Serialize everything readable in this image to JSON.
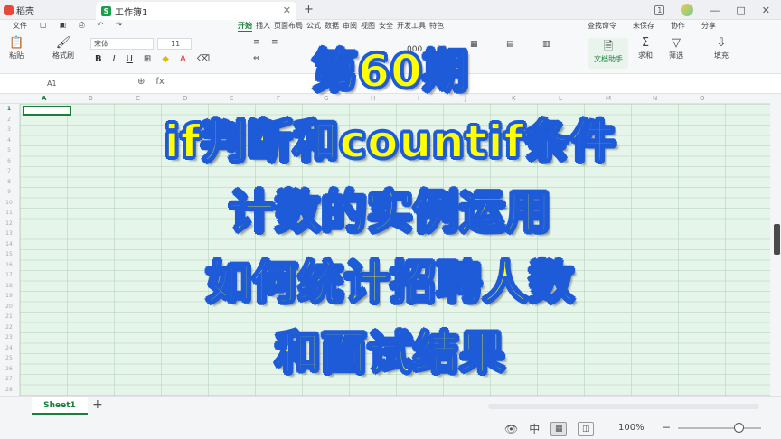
{
  "app": {
    "name": "稻壳",
    "logo_icon": "daoke-logo-icon"
  },
  "document_tab": {
    "title": "工作簿1",
    "icon": "spreadsheet-icon"
  },
  "title_controls": {
    "page_badge": "1"
  },
  "menu": {
    "left_items": [
      "文件",
      "",
      "",
      ""
    ],
    "tabs": [
      "开始",
      "插入",
      "页面布局",
      "公式",
      "数据",
      "审阅",
      "视图",
      "安全",
      "开发工具",
      "特色"
    ],
    "right_items": [
      "查找命令",
      "未保存",
      "协作",
      "分享"
    ]
  },
  "ribbon": {
    "paste_label": "粘贴",
    "format_painter_label": "格式刷",
    "font_name": "宋体",
    "font_size": "11",
    "doc_helper_label": "文档助手",
    "sum_label": "求和",
    "filter_label": "筛选",
    "fill_label": "填充"
  },
  "formula_bar": {
    "cell_ref": "A1",
    "fx_label": "fx"
  },
  "columns": [
    "A",
    "B",
    "C",
    "D",
    "E",
    "F",
    "G",
    "H",
    "I",
    "J",
    "K",
    "L",
    "M",
    "N",
    "O"
  ],
  "rows": [
    "1",
    "2",
    "3",
    "4",
    "5",
    "6",
    "7",
    "8",
    "9",
    "10",
    "11",
    "12",
    "13",
    "14",
    "15",
    "16",
    "17",
    "18",
    "19",
    "20",
    "21",
    "22",
    "23",
    "24",
    "25",
    "26",
    "27",
    "28"
  ],
  "sheet": {
    "tab_name": "Sheet1",
    "add_label": "+"
  },
  "status": {
    "zoom": "100%"
  },
  "overlay": {
    "lines": [
      "第60期",
      "if判断和countif条件",
      "计数的实例运用",
      "如何统计招聘人数",
      "和面试结果"
    ],
    "text_color": "#ffff00",
    "outline_color": "#1e5bd8"
  },
  "colors": {
    "accent": "#1a7f3c",
    "grid_fill": "#e6f5e9"
  }
}
